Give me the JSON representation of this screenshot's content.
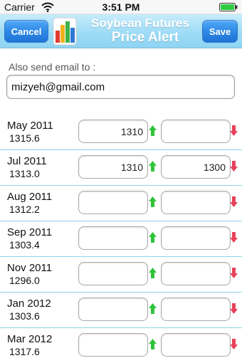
{
  "status_bar": {
    "carrier": "Carrier",
    "time": "3:51 PM",
    "wifi_icon": "wifi-icon",
    "battery_icon": "battery-icon"
  },
  "header": {
    "cancel_label": "Cancel",
    "title_line1": "Soybean Futures",
    "title_line2": "Price Alert",
    "save_label": "Save",
    "logo_icon": "bar-chart-logo-icon",
    "colors": {
      "nav_background": "#9edcf6",
      "button": "#2f89e6",
      "title_text": "#ffffff"
    }
  },
  "email": {
    "label": "Also send email to :",
    "value": "mizyeh@gmail.com"
  },
  "futures": [
    {
      "month": "May 2011",
      "price": "1315.6",
      "high_alert": "1310",
      "low_alert": ""
    },
    {
      "month": "Jul 2011",
      "price": "1313.0",
      "high_alert": "1310",
      "low_alert": "1300"
    },
    {
      "month": "Aug 2011",
      "price": "1312.2",
      "high_alert": "",
      "low_alert": ""
    },
    {
      "month": "Sep 2011",
      "price": "1303.4",
      "high_alert": "",
      "low_alert": ""
    },
    {
      "month": "Nov 2011",
      "price": "1296.0",
      "high_alert": "",
      "low_alert": ""
    },
    {
      "month": "Jan 2012",
      "price": "1303.6",
      "high_alert": "",
      "low_alert": ""
    },
    {
      "month": "Mar 2012",
      "price": "1317.6",
      "high_alert": "",
      "low_alert": ""
    }
  ],
  "icons": {
    "up": "arrow-up-icon",
    "down": "arrow-down-icon",
    "up_color": "#2fc43a",
    "down_color": "#e8415a"
  }
}
